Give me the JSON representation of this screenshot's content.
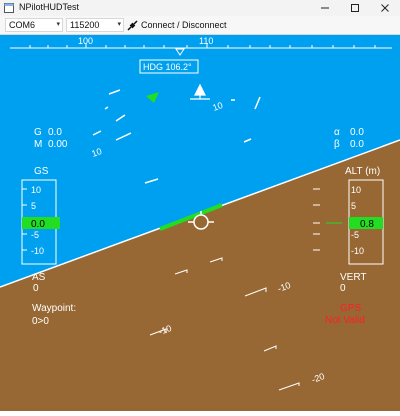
{
  "window": {
    "title": "NPilotHUDTest",
    "minimize_icon": "minimize-icon",
    "maximize_icon": "maximize-icon",
    "close_icon": "close-icon"
  },
  "toolbar": {
    "port": "COM6",
    "baud": "115200",
    "connect_label": "Connect / Disconnect",
    "connect_icon": "plug-icon"
  },
  "hud": {
    "colors": {
      "sky": "#00a0f0",
      "ground": "#976834",
      "accent": "#22dd22",
      "warning": "#ff2020",
      "text": "#ffffff"
    },
    "heading": {
      "label": "HDG 106.2°",
      "tick_labels": [
        "100",
        "110"
      ]
    },
    "pitch_labels": [
      "10",
      "10",
      "-10",
      "-10",
      "-20"
    ],
    "g": {
      "label": "G",
      "value": "0.0"
    },
    "mach": {
      "label": "M",
      "value": "0.00"
    },
    "alpha": {
      "label": "α",
      "value": "0.0"
    },
    "beta": {
      "label": "β",
      "value": "0.0"
    },
    "gs": {
      "label": "GS",
      "ticks": [
        "10",
        "5",
        "-5",
        "-10"
      ],
      "value": "0.0"
    },
    "alt": {
      "label": "ALT (m)",
      "ticks": [
        "10",
        "5",
        "-5",
        "-10"
      ],
      "value": "0.8"
    },
    "as": {
      "label": "AS",
      "value": "0"
    },
    "vert": {
      "label": "VERT",
      "value": "0"
    },
    "waypoint": {
      "label": "Waypoint:",
      "value": "0>0"
    },
    "gps": {
      "label": "GPS",
      "status": "Not Valid"
    }
  }
}
